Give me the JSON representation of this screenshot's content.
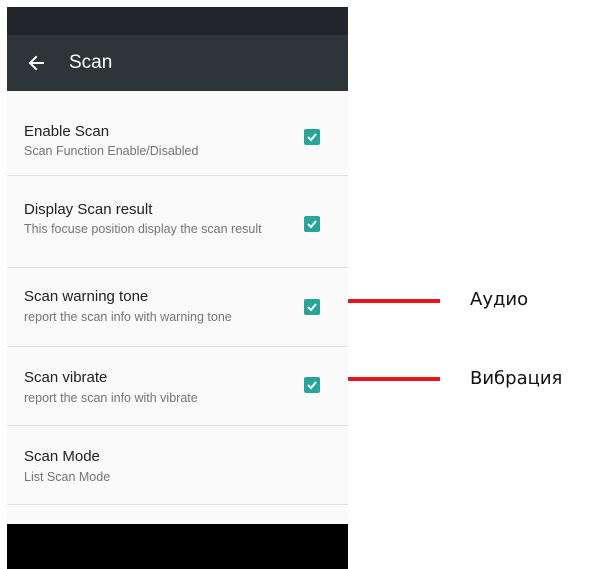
{
  "app_bar": {
    "title": "Scan",
    "back_icon": "arrow-left-icon"
  },
  "settings": [
    {
      "title": "Enable Scan",
      "summary": "Scan Function Enable/Disabled",
      "checked": true
    },
    {
      "title": "Display Scan result",
      "summary": "This focuse position display the scan result",
      "checked": true
    },
    {
      "title": "Scan warning tone",
      "summary": "report the scan info with warning tone",
      "checked": true
    },
    {
      "title": "Scan vibrate",
      "summary": "report the scan info with vibrate",
      "checked": true
    },
    {
      "title": "Scan Mode",
      "summary": "List Scan Mode"
    }
  ],
  "annotations": [
    {
      "label": "Аудио",
      "color": "#e8161c"
    },
    {
      "label": "Вибрация",
      "color": "#e8161c"
    }
  ],
  "colors": {
    "accent": "#26a69a",
    "app_bar": "#2d3539",
    "status_bar": "#22262a"
  }
}
